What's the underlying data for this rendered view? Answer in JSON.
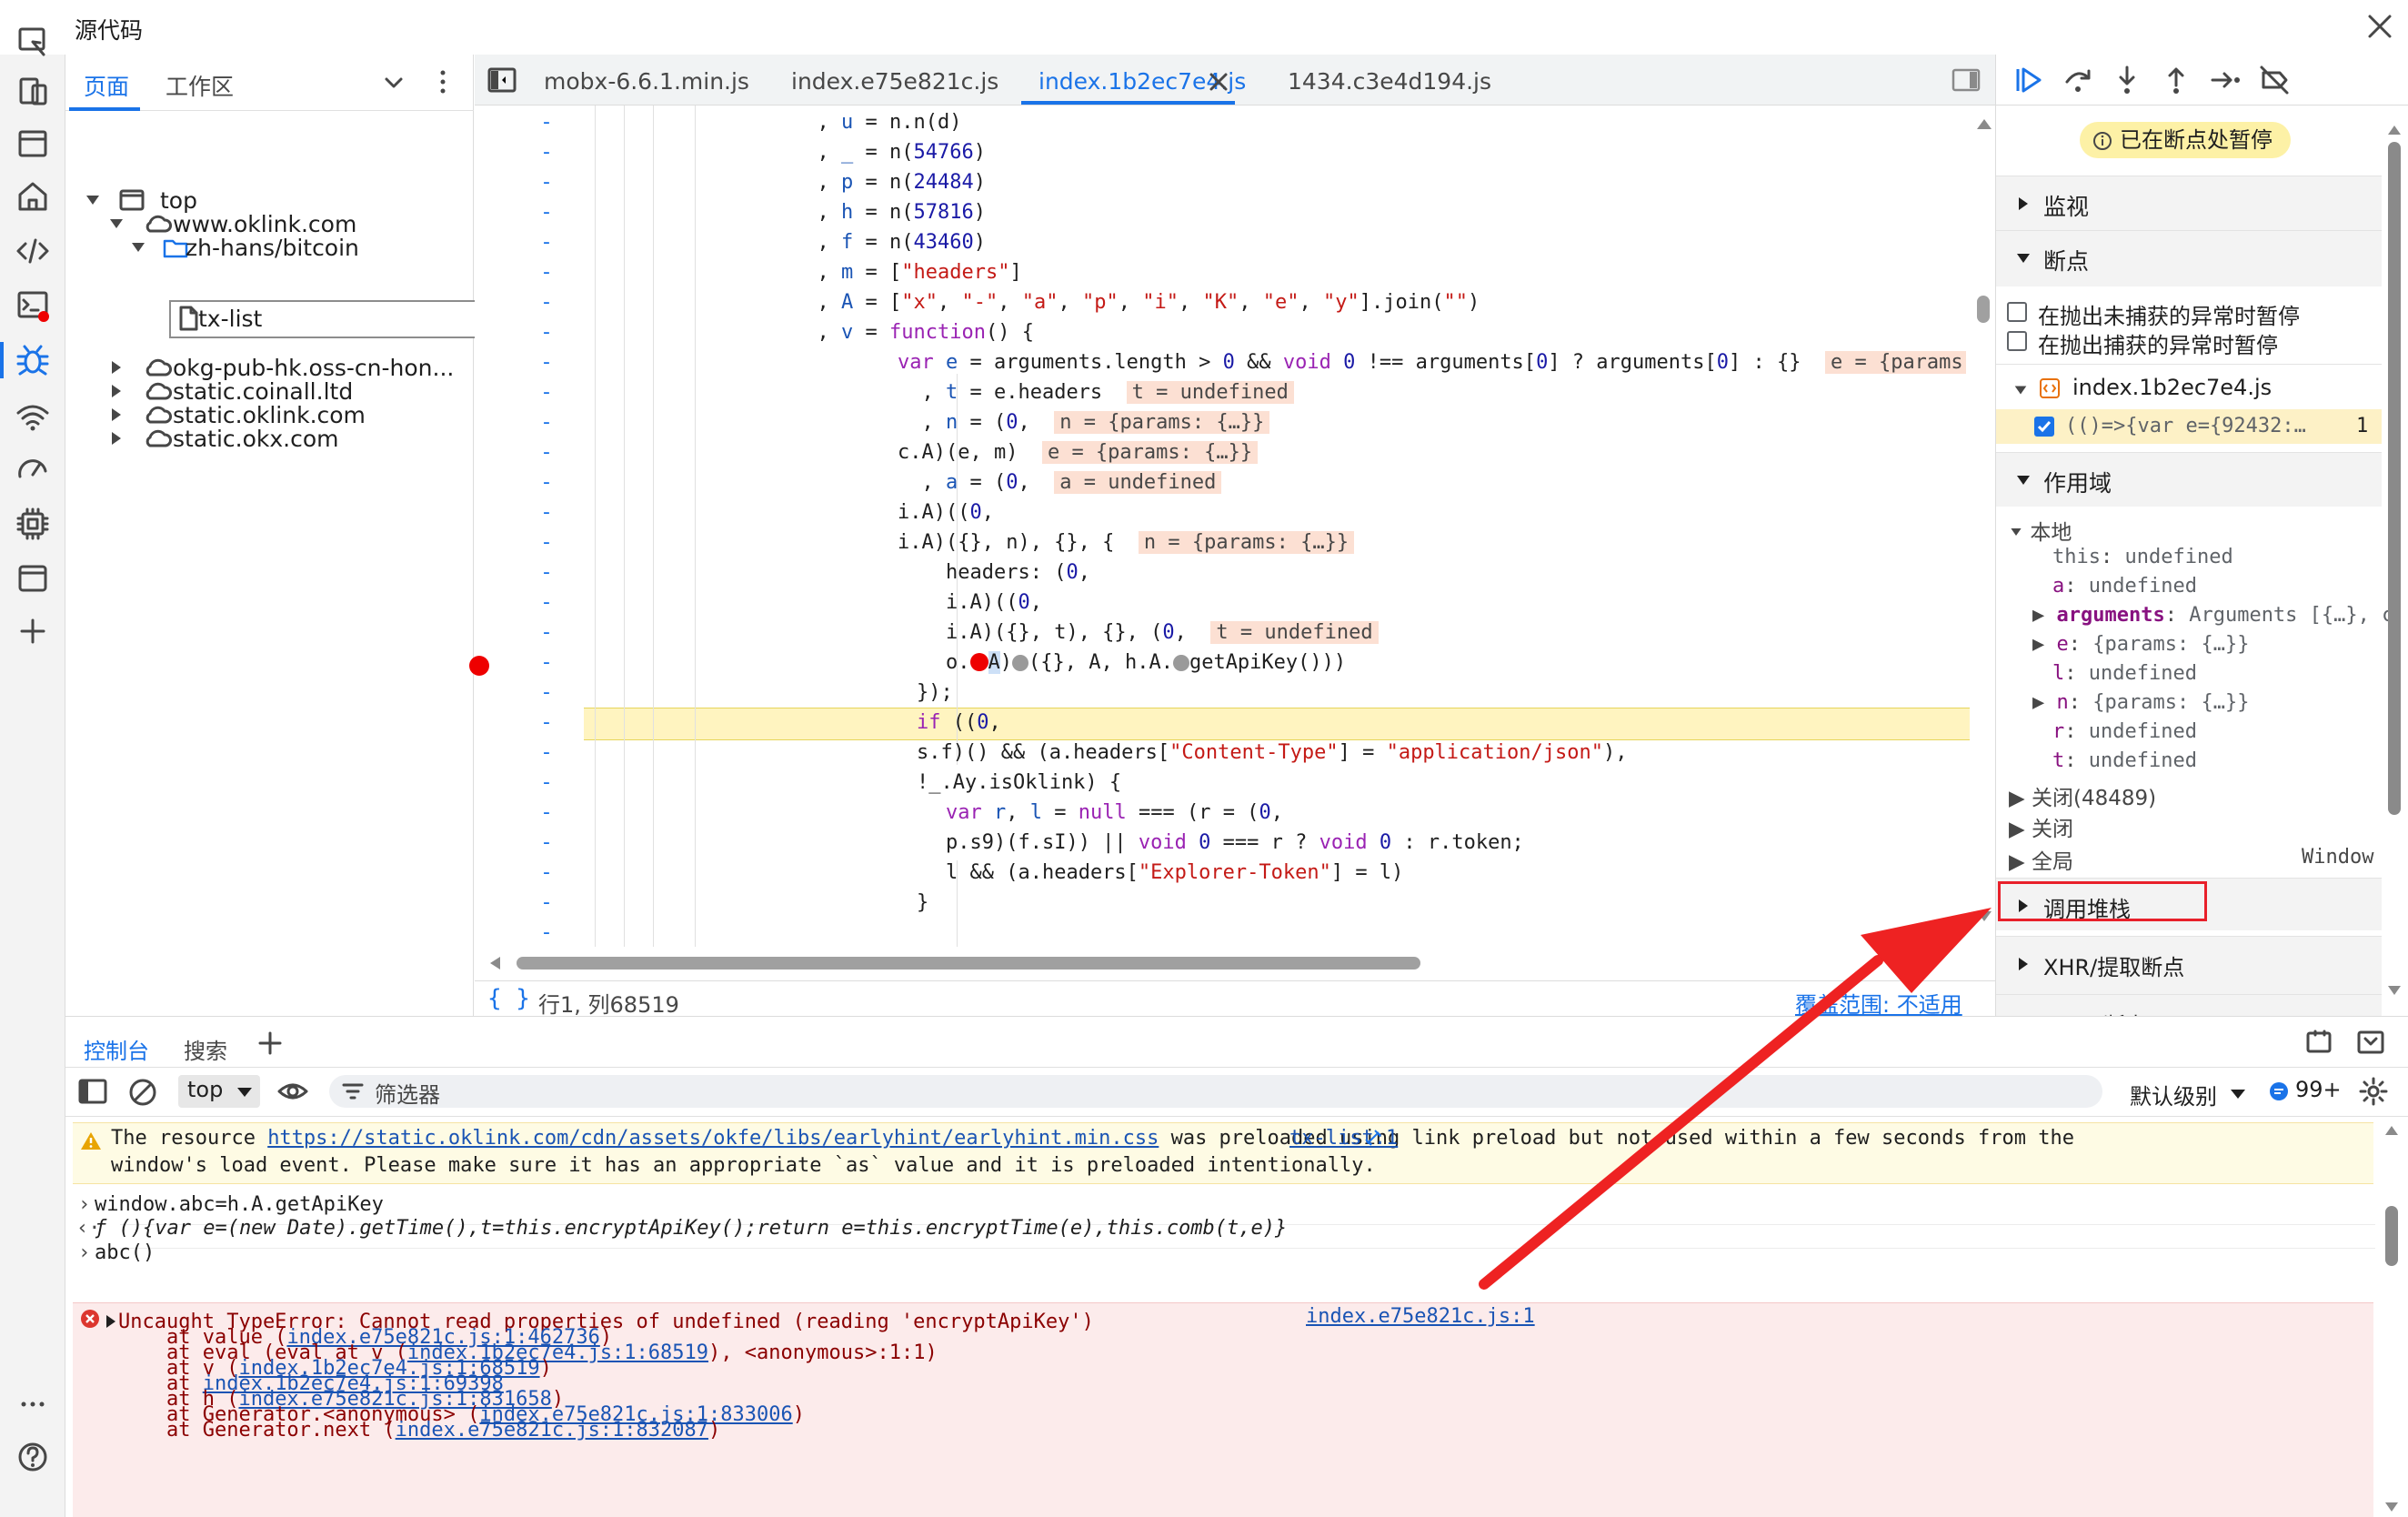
{
  "window": {
    "title": "源代码"
  },
  "navigator": {
    "tabs": [
      "页面",
      "工作区"
    ],
    "tree": [
      {
        "label": "top"
      },
      {
        "label": "www.oklink.com"
      },
      {
        "label": "zh-hans/bitcoin"
      },
      {
        "label": "tx-list"
      },
      {
        "label": "okg-pub-hk.oss-cn-hon..."
      },
      {
        "label": "static.coinall.ltd"
      },
      {
        "label": "static.oklink.com"
      },
      {
        "label": "static.okx.com"
      }
    ]
  },
  "editor": {
    "tabs": [
      "mobx-6.6.1.min.js",
      "index.e75e821c.js",
      "index.1b2ec7e4.js",
      "1434.c3e4d194.js"
    ],
    "status": {
      "position": "行1, 列68519",
      "coverage": "覆盖范围: 不适用"
    },
    "inline": {
      "l9": "e = {params: {…}}, arg",
      "l10": "t = undefined",
      "l11": "n = {params: {…}}",
      "l12": "e = {params: {…}}",
      "l13": "a = undefined",
      "l15": "n = {params: {…}}",
      "l18": "t = undefined"
    }
  },
  "debugger": {
    "paused": "已在断点处暂停",
    "watch": "监视",
    "breakpoints": "断点",
    "pause_uncaught": "在抛出未捕获的异常时暂停",
    "pause_caught": "在抛出捕获的异常时暂停",
    "bp_file": "index.1b2ec7e4.js",
    "bp_line_text": "(()=>{var e={92432:…",
    "bp_line_no": "1",
    "scope": "作用域",
    "local": "本地",
    "vars": [
      {
        "name": "this",
        "value": "undefined"
      },
      {
        "name": "a",
        "value": "undefined"
      },
      {
        "name": "arguments",
        "value": "Arguments [{…}, c"
      },
      {
        "name": "e",
        "value": "{params: {…}}"
      },
      {
        "name": "l",
        "value": "undefined"
      },
      {
        "name": "n",
        "value": "{params: {…}}"
      },
      {
        "name": "r",
        "value": "undefined"
      },
      {
        "name": "t",
        "value": "undefined"
      }
    ],
    "closure1": "关闭(48489)",
    "closure2": "关闭",
    "global": "全局",
    "global_val": "Window",
    "callstack": "调用堆栈",
    "xhr": "XHR/提取断点",
    "dom": "DOM 断点"
  },
  "drawer": {
    "tabs": [
      "控制台",
      "搜索"
    ],
    "context": "top",
    "filter": "筛选器",
    "level": "默认级别",
    "count": "99+",
    "warning": {
      "pre": "The resource ",
      "url": "https://static.oklink.com/cdn/assets/okfe/libs/earlyhint/earlyhint.min.css",
      "post": " was preloaded using link preload but not used within a few seconds from the",
      "line2": "window's load event. Please make sure it has an appropriate `as` value and it is preloaded intentionally.",
      "src": "tx-list:1"
    },
    "input1": "window.abc=h.A.getApiKey",
    "output1": "ƒ (){var e=(new Date).getTime(),t=this.encryptApiKey();return e=this.encryptTime(e),this.comb(t,e)}",
    "input2": "abc()",
    "error": {
      "msg": "Uncaught TypeError: Cannot read properties of undefined (reading 'encryptApiKey')",
      "src": "index.e75e821c.js:1",
      "frames": [
        {
          "pre": "    at value (",
          "link": "index.e75e821c.js:1:462736",
          "post": ")"
        },
        {
          "pre": "    at eval (eval at v (",
          "link": "index.1b2ec7e4.js:1:68519",
          "post": "), <anonymous>:1:1)"
        },
        {
          "pre": "    at v (",
          "link": "index.1b2ec7e4.js:1:68519",
          "post": ")"
        },
        {
          "pre": "    at ",
          "link": "index.1b2ec7e4.js:1:69398",
          "post": ""
        },
        {
          "pre": "    at h (",
          "link": "index.e75e821c.js:1:831658",
          "post": ")"
        },
        {
          "pre": "    at Generator.<anonymous> (",
          "link": "index.e75e821c.js:1:833006",
          "post": ")"
        },
        {
          "pre": "    at Generator.next (",
          "link": "index.e75e821c.js:1:832087",
          "post": ")"
        }
      ]
    }
  },
  "colors": {
    "accent": "#1a73e8",
    "breakpoint": "#e00000",
    "annotation": "#e8202a",
    "paused_bg": "#fdf1a6"
  }
}
